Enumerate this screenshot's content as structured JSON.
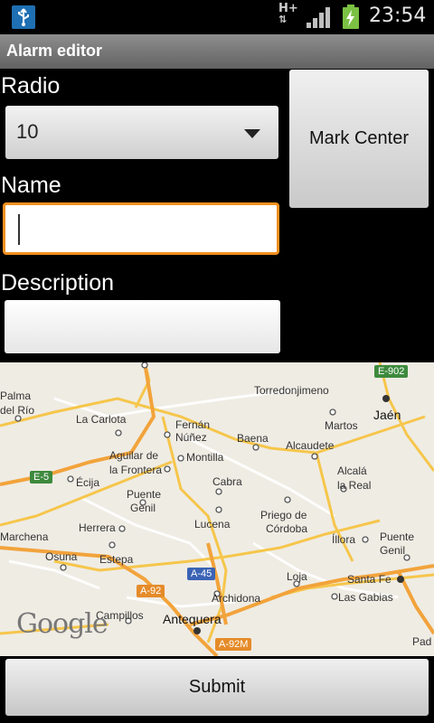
{
  "status_bar": {
    "time": "23:54",
    "network": "H+",
    "icons": [
      "usb-icon",
      "signal-icon",
      "battery-charging-icon"
    ]
  },
  "title_bar": {
    "title": "Alarm editor"
  },
  "form": {
    "radio_label": "Radio",
    "radio_value": "10",
    "mark_center_label": "Mark Center",
    "name_label": "Name",
    "name_value": "",
    "description_label": "Description",
    "description_value": "",
    "submit_label": "Submit"
  },
  "map": {
    "provider": "Google",
    "places": [
      {
        "name": "Palma",
        "big": false
      },
      {
        "name": "del Río",
        "big": false
      },
      {
        "name": "La Carlota",
        "big": false
      },
      {
        "name": "Fernán",
        "big": false
      },
      {
        "name": "Núñez",
        "big": false
      },
      {
        "name": "Torredonjimeno",
        "big": false
      },
      {
        "name": "Martos",
        "big": false
      },
      {
        "name": "Jaén",
        "big": true
      },
      {
        "name": "Baena",
        "big": false
      },
      {
        "name": "Alcaudete",
        "big": false
      },
      {
        "name": "Aguilar de",
        "big": false
      },
      {
        "name": "la Frontera",
        "big": false
      },
      {
        "name": "Montilla",
        "big": false
      },
      {
        "name": "Écija",
        "big": false
      },
      {
        "name": "Cabra",
        "big": false
      },
      {
        "name": "Alcalá",
        "big": false
      },
      {
        "name": "la Real",
        "big": false
      },
      {
        "name": "Puente",
        "big": false
      },
      {
        "name": "Genil",
        "big": false
      },
      {
        "name": "Herrera",
        "big": false
      },
      {
        "name": "Lucena",
        "big": false
      },
      {
        "name": "Priego de",
        "big": false
      },
      {
        "name": "Córdoba",
        "big": false
      },
      {
        "name": "Marchena",
        "big": false
      },
      {
        "name": "Íllora",
        "big": false
      },
      {
        "name": "Puente",
        "big": false
      },
      {
        "name": "Genil",
        "big": false
      },
      {
        "name": "Osuna",
        "big": false
      },
      {
        "name": "Estepa",
        "big": false
      },
      {
        "name": "Loja",
        "big": false
      },
      {
        "name": "Santa Fe",
        "big": false
      },
      {
        "name": "Las Gabias",
        "big": false
      },
      {
        "name": "Archidona",
        "big": false
      },
      {
        "name": "Campillos",
        "big": false
      },
      {
        "name": "Antequera",
        "big": true
      },
      {
        "name": "Pad",
        "big": false
      }
    ],
    "roads": [
      "E-902",
      "E-5",
      "A-45",
      "A-92",
      "A-92M"
    ]
  }
}
